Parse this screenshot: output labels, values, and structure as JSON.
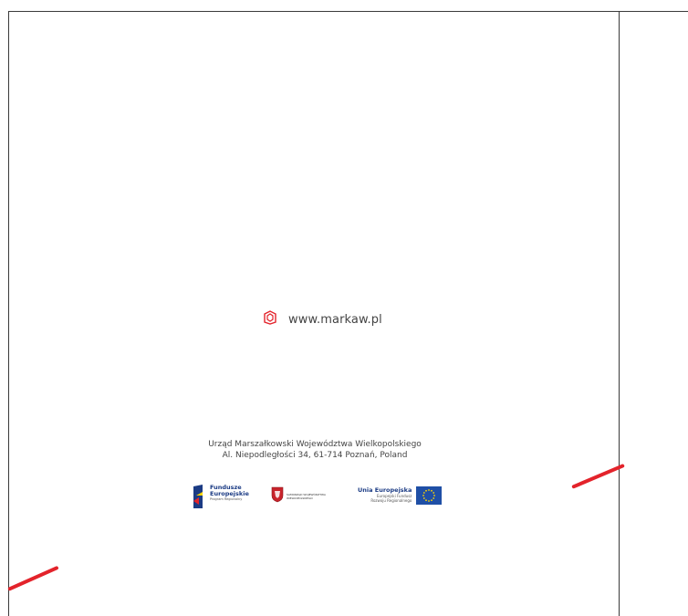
{
  "website": {
    "url": "www.markaw.pl",
    "icon": "markaw-logo-icon"
  },
  "address": {
    "line1": "Urząd Marszałkowski Województwa Wielkopolskiego",
    "line2": "Al. Niepodległości 34, 61-714 Poznań, Poland"
  },
  "logos": {
    "fundusze": {
      "line1": "Fundusze",
      "line2": "Europejskie",
      "line3": "Program Regionalny"
    },
    "samorzad": {
      "line1": "SAMORZĄD WOJEWÓDZTWA",
      "line2": "WIELKOPOLSKIEGO"
    },
    "unia": {
      "title": "Unia Europejska",
      "line1": "Europejski Fundusz",
      "line2": "Rozwoju Regionalnego"
    }
  },
  "colors": {
    "accent": "#e3232b",
    "eu_blue": "#1f4fa6",
    "eu_star": "#ffd500",
    "fe_blue": "#1b3b84"
  }
}
